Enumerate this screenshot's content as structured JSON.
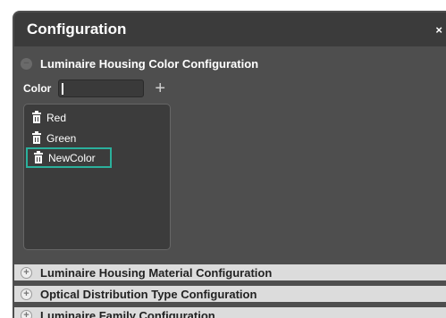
{
  "dialog": {
    "title": "Configuration",
    "close_label": "×"
  },
  "sections": {
    "open_toggle": "−",
    "closed_toggle": "+",
    "housing_color": "Luminaire Housing Color Configuration",
    "housing_material": "Luminaire Housing Material Configuration",
    "optical_distribution": "Optical Distribution Type Configuration",
    "family": "Luminaire Family Configuration"
  },
  "color_form": {
    "label": "Color",
    "value": "",
    "add_label": "+"
  },
  "colors": [
    "Red",
    "Green",
    "NewColor"
  ],
  "icons": {
    "delete": "trash-icon",
    "expand": "plus-circle-icon",
    "collapse": "minus-circle-icon",
    "close": "close-icon"
  },
  "accent_color": "#2bb09c"
}
